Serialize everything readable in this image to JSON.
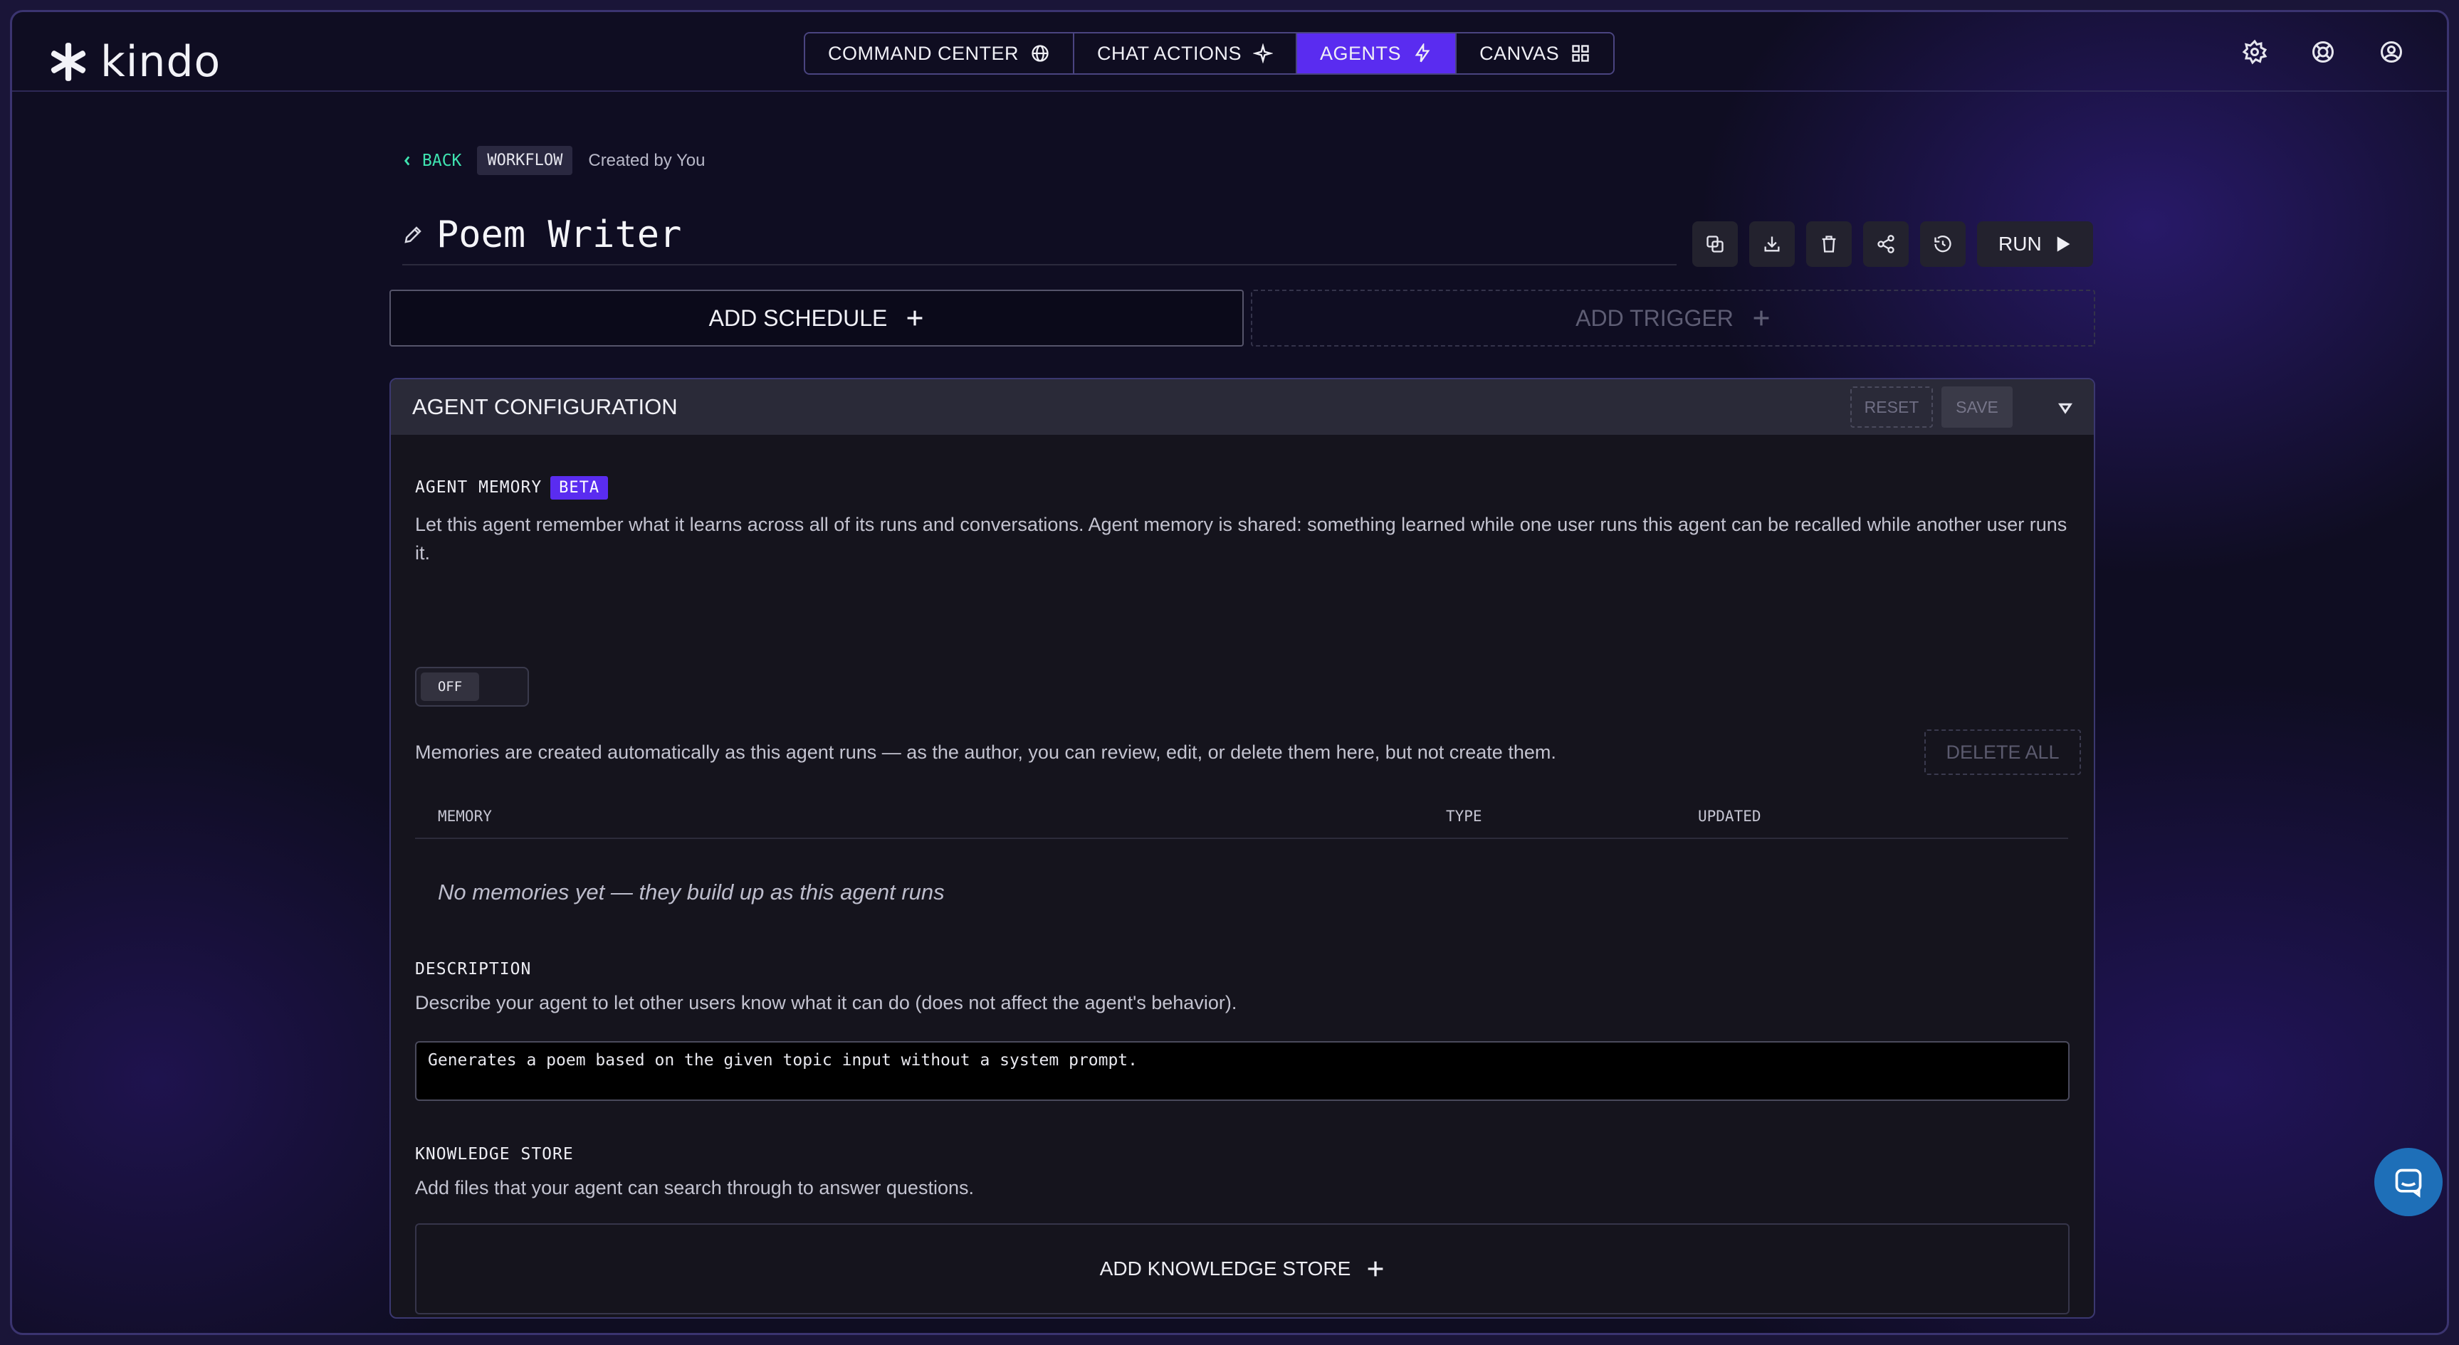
{
  "app": {
    "logo_text": "kindo"
  },
  "nav": {
    "tabs": [
      {
        "label": "COMMAND CENTER",
        "icon": "globe-icon"
      },
      {
        "label": "CHAT ACTIONS",
        "icon": "sparkle-icon"
      },
      {
        "label": "AGENTS",
        "icon": "lightning-icon",
        "active": true
      },
      {
        "label": "CANVAS",
        "icon": "grid-icon"
      }
    ],
    "right_icons": [
      "gear-icon",
      "help-ring-icon",
      "account-icon"
    ]
  },
  "breadcrumb": {
    "back_label": "BACK",
    "type_badge": "WORKFLOW",
    "created_by": "Created by You"
  },
  "agent": {
    "title": "Poem Writer"
  },
  "actions": {
    "icons": [
      "duplicate-icon",
      "download-icon",
      "trash-icon",
      "share-icon",
      "history-icon"
    ],
    "run_label": "RUN"
  },
  "schedule": {
    "add_schedule_label": "ADD SCHEDULE",
    "add_trigger_label": "ADD TRIGGER"
  },
  "config": {
    "title": "AGENT CONFIGURATION",
    "reset_label": "RESET",
    "save_label": "SAVE",
    "memory": {
      "label": "AGENT MEMORY",
      "badge": "BETA",
      "description": "Let this agent remember what it learns across all of its runs and conversations. Agent memory is shared: something learned while one user runs this agent can be recalled while another user runs it.",
      "toggle_label": "OFF",
      "note": "Memories are created automatically as this agent runs — as the author, you can review, edit, or delete them here, but not create them.",
      "delete_all_label": "DELETE ALL",
      "columns": [
        "MEMORY",
        "TYPE",
        "UPDATED"
      ],
      "empty_text": "No memories yet — they build up as this agent runs"
    },
    "description": {
      "label": "DESCRIPTION",
      "help": "Describe your agent to let other users know what it can do (does not affect the agent's behavior).",
      "value": "Generates a poem based on the given topic input without a system prompt."
    },
    "knowledge": {
      "label": "KNOWLEDGE STORE",
      "help": "Add files that your agent can search through to answer questions.",
      "add_label": "ADD KNOWLEDGE STORE"
    }
  },
  "colors": {
    "accent": "#5a2cf0",
    "link": "#3fe3b0",
    "chat": "#1e6fb8"
  }
}
